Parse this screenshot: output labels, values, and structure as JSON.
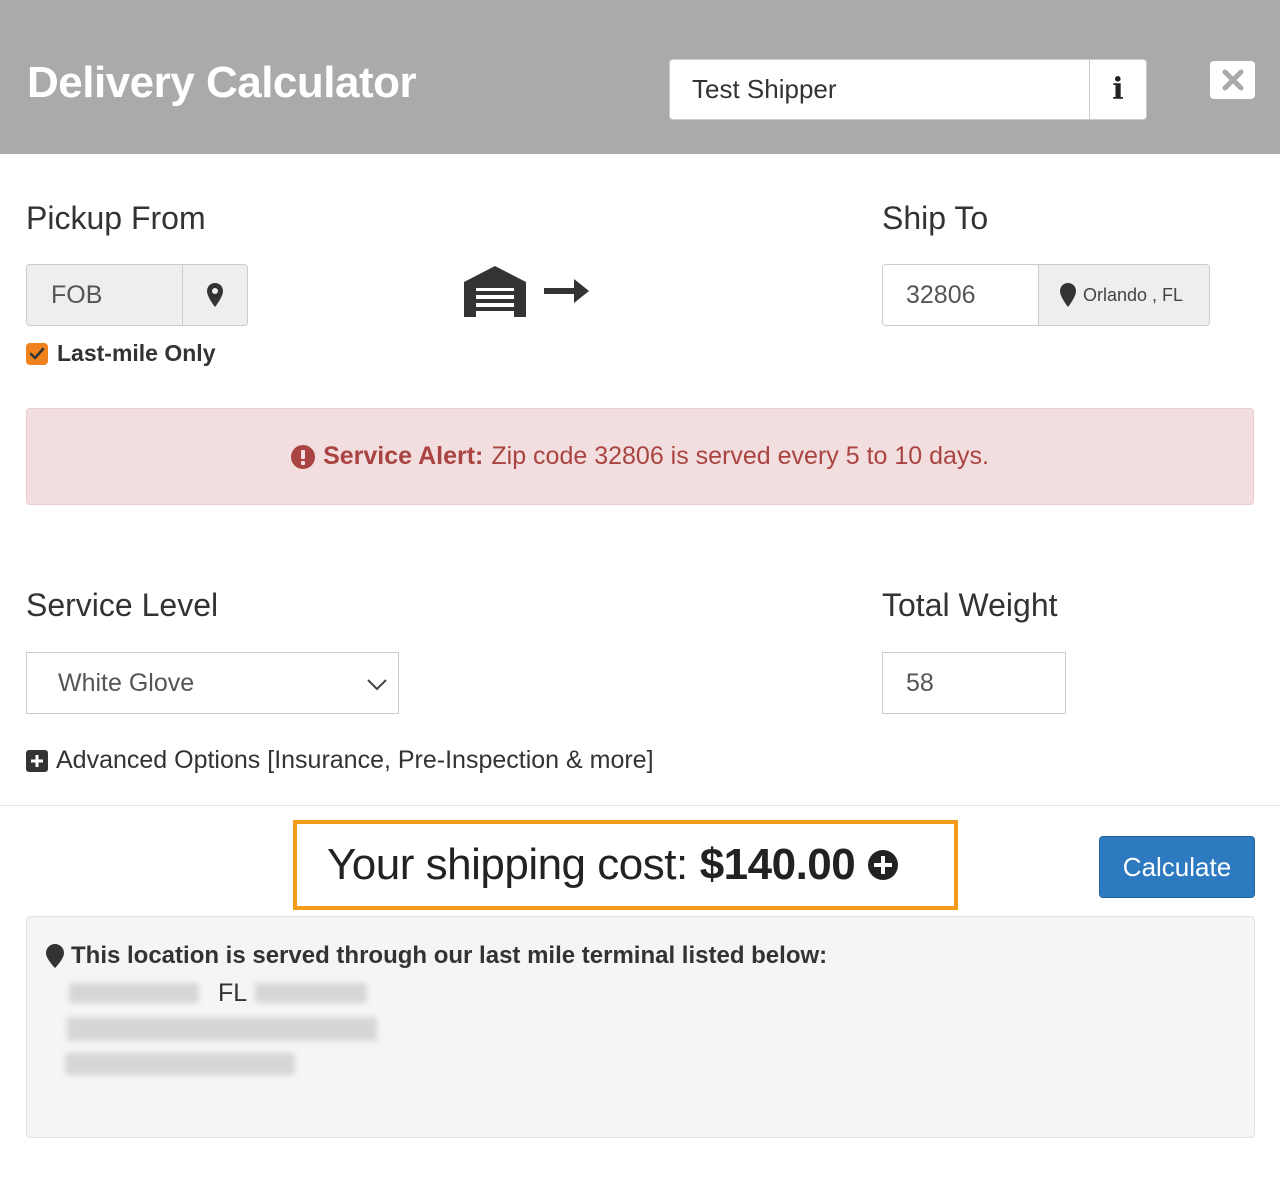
{
  "header": {
    "title": "Delivery Calculator",
    "shipper_value": "Test Shipper",
    "info_glyph": "i",
    "close_icon": "close-icon"
  },
  "pickup": {
    "label": "Pickup From",
    "value": "FOB",
    "pin_icon": "map-pin-icon",
    "last_mile_checked": true,
    "last_mile_label": "Last-mile Only"
  },
  "route_icons": [
    "warehouse-icon",
    "arrow-right-icon"
  ],
  "ship_to": {
    "label": "Ship To",
    "zip": "32806",
    "city": "Orlando , FL"
  },
  "alert": {
    "title": "Service Alert:",
    "message": "Zip code 32806 is served every 5 to 10 days."
  },
  "service_level": {
    "label": "Service Level",
    "selected": "White Glove"
  },
  "total_weight": {
    "label": "Total Weight",
    "value": "58"
  },
  "advanced": {
    "label": "Advanced Options [Insurance, Pre-Inspection & more]"
  },
  "cost": {
    "label": "Your shipping cost:",
    "value": "$140.00"
  },
  "calculate_label": "Calculate",
  "terminal": {
    "heading": "This location is served through our last mile terminal listed below:",
    "state": "FL"
  },
  "colors": {
    "header_bg": "#aaaaaa",
    "accent_orange": "#f39c1a",
    "checkbox_orange": "#f0821e",
    "primary_blue": "#2d7ac0",
    "alert_bg": "#f2dede",
    "alert_text": "#a94442"
  }
}
